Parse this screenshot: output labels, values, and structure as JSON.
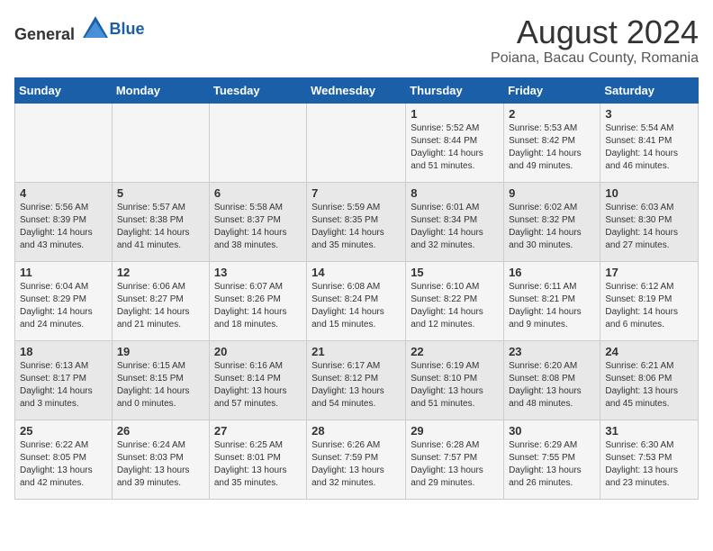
{
  "header": {
    "logo_general": "General",
    "logo_blue": "Blue",
    "title": "August 2024",
    "subtitle": "Poiana, Bacau County, Romania"
  },
  "columns": [
    "Sunday",
    "Monday",
    "Tuesday",
    "Wednesday",
    "Thursday",
    "Friday",
    "Saturday"
  ],
  "weeks": [
    [
      {
        "day": "",
        "info": ""
      },
      {
        "day": "",
        "info": ""
      },
      {
        "day": "",
        "info": ""
      },
      {
        "day": "",
        "info": ""
      },
      {
        "day": "1",
        "info": "Sunrise: 5:52 AM\nSunset: 8:44 PM\nDaylight: 14 hours\nand 51 minutes."
      },
      {
        "day": "2",
        "info": "Sunrise: 5:53 AM\nSunset: 8:42 PM\nDaylight: 14 hours\nand 49 minutes."
      },
      {
        "day": "3",
        "info": "Sunrise: 5:54 AM\nSunset: 8:41 PM\nDaylight: 14 hours\nand 46 minutes."
      }
    ],
    [
      {
        "day": "4",
        "info": "Sunrise: 5:56 AM\nSunset: 8:39 PM\nDaylight: 14 hours\nand 43 minutes."
      },
      {
        "day": "5",
        "info": "Sunrise: 5:57 AM\nSunset: 8:38 PM\nDaylight: 14 hours\nand 41 minutes."
      },
      {
        "day": "6",
        "info": "Sunrise: 5:58 AM\nSunset: 8:37 PM\nDaylight: 14 hours\nand 38 minutes."
      },
      {
        "day": "7",
        "info": "Sunrise: 5:59 AM\nSunset: 8:35 PM\nDaylight: 14 hours\nand 35 minutes."
      },
      {
        "day": "8",
        "info": "Sunrise: 6:01 AM\nSunset: 8:34 PM\nDaylight: 14 hours\nand 32 minutes."
      },
      {
        "day": "9",
        "info": "Sunrise: 6:02 AM\nSunset: 8:32 PM\nDaylight: 14 hours\nand 30 minutes."
      },
      {
        "day": "10",
        "info": "Sunrise: 6:03 AM\nSunset: 8:30 PM\nDaylight: 14 hours\nand 27 minutes."
      }
    ],
    [
      {
        "day": "11",
        "info": "Sunrise: 6:04 AM\nSunset: 8:29 PM\nDaylight: 14 hours\nand 24 minutes."
      },
      {
        "day": "12",
        "info": "Sunrise: 6:06 AM\nSunset: 8:27 PM\nDaylight: 14 hours\nand 21 minutes."
      },
      {
        "day": "13",
        "info": "Sunrise: 6:07 AM\nSunset: 8:26 PM\nDaylight: 14 hours\nand 18 minutes."
      },
      {
        "day": "14",
        "info": "Sunrise: 6:08 AM\nSunset: 8:24 PM\nDaylight: 14 hours\nand 15 minutes."
      },
      {
        "day": "15",
        "info": "Sunrise: 6:10 AM\nSunset: 8:22 PM\nDaylight: 14 hours\nand 12 minutes."
      },
      {
        "day": "16",
        "info": "Sunrise: 6:11 AM\nSunset: 8:21 PM\nDaylight: 14 hours\nand 9 minutes."
      },
      {
        "day": "17",
        "info": "Sunrise: 6:12 AM\nSunset: 8:19 PM\nDaylight: 14 hours\nand 6 minutes."
      }
    ],
    [
      {
        "day": "18",
        "info": "Sunrise: 6:13 AM\nSunset: 8:17 PM\nDaylight: 14 hours\nand 3 minutes."
      },
      {
        "day": "19",
        "info": "Sunrise: 6:15 AM\nSunset: 8:15 PM\nDaylight: 14 hours\nand 0 minutes."
      },
      {
        "day": "20",
        "info": "Sunrise: 6:16 AM\nSunset: 8:14 PM\nDaylight: 13 hours\nand 57 minutes."
      },
      {
        "day": "21",
        "info": "Sunrise: 6:17 AM\nSunset: 8:12 PM\nDaylight: 13 hours\nand 54 minutes."
      },
      {
        "day": "22",
        "info": "Sunrise: 6:19 AM\nSunset: 8:10 PM\nDaylight: 13 hours\nand 51 minutes."
      },
      {
        "day": "23",
        "info": "Sunrise: 6:20 AM\nSunset: 8:08 PM\nDaylight: 13 hours\nand 48 minutes."
      },
      {
        "day": "24",
        "info": "Sunrise: 6:21 AM\nSunset: 8:06 PM\nDaylight: 13 hours\nand 45 minutes."
      }
    ],
    [
      {
        "day": "25",
        "info": "Sunrise: 6:22 AM\nSunset: 8:05 PM\nDaylight: 13 hours\nand 42 minutes."
      },
      {
        "day": "26",
        "info": "Sunrise: 6:24 AM\nSunset: 8:03 PM\nDaylight: 13 hours\nand 39 minutes."
      },
      {
        "day": "27",
        "info": "Sunrise: 6:25 AM\nSunset: 8:01 PM\nDaylight: 13 hours\nand 35 minutes."
      },
      {
        "day": "28",
        "info": "Sunrise: 6:26 AM\nSunset: 7:59 PM\nDaylight: 13 hours\nand 32 minutes."
      },
      {
        "day": "29",
        "info": "Sunrise: 6:28 AM\nSunset: 7:57 PM\nDaylight: 13 hours\nand 29 minutes."
      },
      {
        "day": "30",
        "info": "Sunrise: 6:29 AM\nSunset: 7:55 PM\nDaylight: 13 hours\nand 26 minutes."
      },
      {
        "day": "31",
        "info": "Sunrise: 6:30 AM\nSunset: 7:53 PM\nDaylight: 13 hours\nand 23 minutes."
      }
    ]
  ]
}
